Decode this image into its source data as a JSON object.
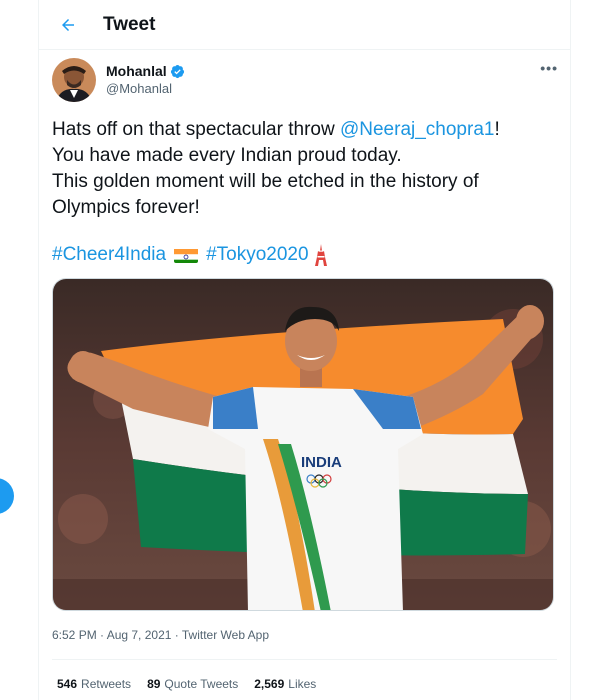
{
  "header": {
    "back_icon": "arrow-left-icon",
    "title": "Tweet"
  },
  "author": {
    "display_name": "Mohanlal",
    "verified_icon": "verified-badge-icon",
    "handle": "@Mohanlal",
    "more_icon": "more-horizontal-icon",
    "more_label": "•••"
  },
  "tweet": {
    "line1_pre": "Hats off on that spectacular throw ",
    "mention": "@Neeraj_chopra1",
    "line1_post": "!",
    "line2": "You have made every Indian proud today.",
    "line3": "This golden moment will be etched in the history of",
    "line4": "Olympics forever!",
    "hashtag1": "#Cheer4India",
    "hashtag2": "#Tokyo2020"
  },
  "media": {
    "jersey_text": "INDIA"
  },
  "meta": {
    "timestamp": "6:52 PM · Aug 7, 2021 · Twitter Web App"
  },
  "stats": {
    "retweets_count": "546",
    "retweets_label": "Retweets",
    "quotes_count": "89",
    "quotes_label": "Quote Tweets",
    "likes_count": "2,569",
    "likes_label": "Likes"
  },
  "colors": {
    "accent": "#1d9bf0",
    "link": "#1b95e0",
    "text_primary": "#0f1419",
    "text_secondary": "#536471"
  }
}
